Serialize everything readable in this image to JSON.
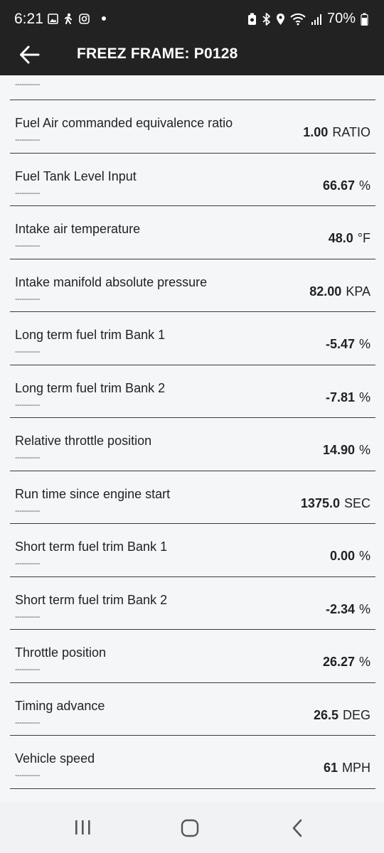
{
  "status_bar": {
    "time": "6:21",
    "battery": "70%",
    "left_icons": [
      "gallery-icon",
      "person-hiking-icon",
      "instagram-icon",
      "dot-icon"
    ],
    "right_icons": [
      "vpn-icon",
      "bluetooth-icon",
      "location-icon",
      "wifi-icon",
      "signal-icon",
      "battery-icon"
    ]
  },
  "app_bar": {
    "title": "FREEZ FRAME: P0128"
  },
  "dash_placeholder": "-----------",
  "rows": [
    {
      "name": "Fuel Air commanded equivalence ratio",
      "value": "1.00",
      "unit": "RATIO",
      "sub": "-----------"
    },
    {
      "name": "Fuel Tank Level Input",
      "value": "66.67",
      "unit": "%",
      "sub": "-----------"
    },
    {
      "name": "Intake air temperature",
      "value": "48.0",
      "unit": "°F",
      "sub": "-----------"
    },
    {
      "name": "Intake manifold absolute pressure",
      "value": "82.00",
      "unit": "KPA",
      "sub": "-----------"
    },
    {
      "name": "Long term fuel trim Bank 1",
      "value": "-5.47",
      "unit": "%",
      "sub": "-----------"
    },
    {
      "name": "Long term fuel trim Bank 2",
      "value": "-7.81",
      "unit": "%",
      "sub": "-----------"
    },
    {
      "name": "Relative throttle position",
      "value": "14.90",
      "unit": "%",
      "sub": "-----------"
    },
    {
      "name": "Run time since engine start",
      "value": "1375.0",
      "unit": "SEC",
      "sub": "-----------"
    },
    {
      "name": "Short term fuel trim Bank 1",
      "value": "0.00",
      "unit": "%",
      "sub": "-----------"
    },
    {
      "name": "Short term fuel trim Bank 2",
      "value": "-2.34",
      "unit": "%",
      "sub": "-----------"
    },
    {
      "name": "Throttle position",
      "value": "26.27",
      "unit": "%",
      "sub": "-----------"
    },
    {
      "name": "Timing advance",
      "value": "26.5",
      "unit": "DEG",
      "sub": "-----------"
    },
    {
      "name": "Vehicle speed",
      "value": "61",
      "unit": "MPH",
      "sub": "-----------"
    }
  ],
  "nav_bar": {
    "icons": [
      "recent-apps-icon",
      "home-icon",
      "back-icon"
    ]
  },
  "colors": {
    "header_bg": "#222222",
    "content_bg": "#f5f6f8",
    "divider": "#3a3a3a"
  }
}
